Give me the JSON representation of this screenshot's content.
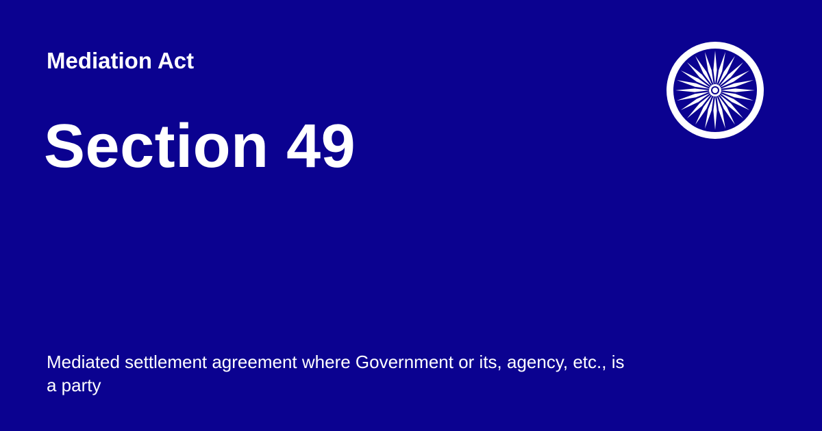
{
  "header": {
    "act_name": "Mediation Act",
    "section": "Section 49"
  },
  "emblem": {
    "icon": "ashoka-chakra-icon",
    "color": "#ffffff",
    "spokes": 24
  },
  "description": "Mediated settlement agreement where Government or its, agency, etc., is a party",
  "colors": {
    "background": "#0b0290",
    "text": "#ffffff"
  }
}
